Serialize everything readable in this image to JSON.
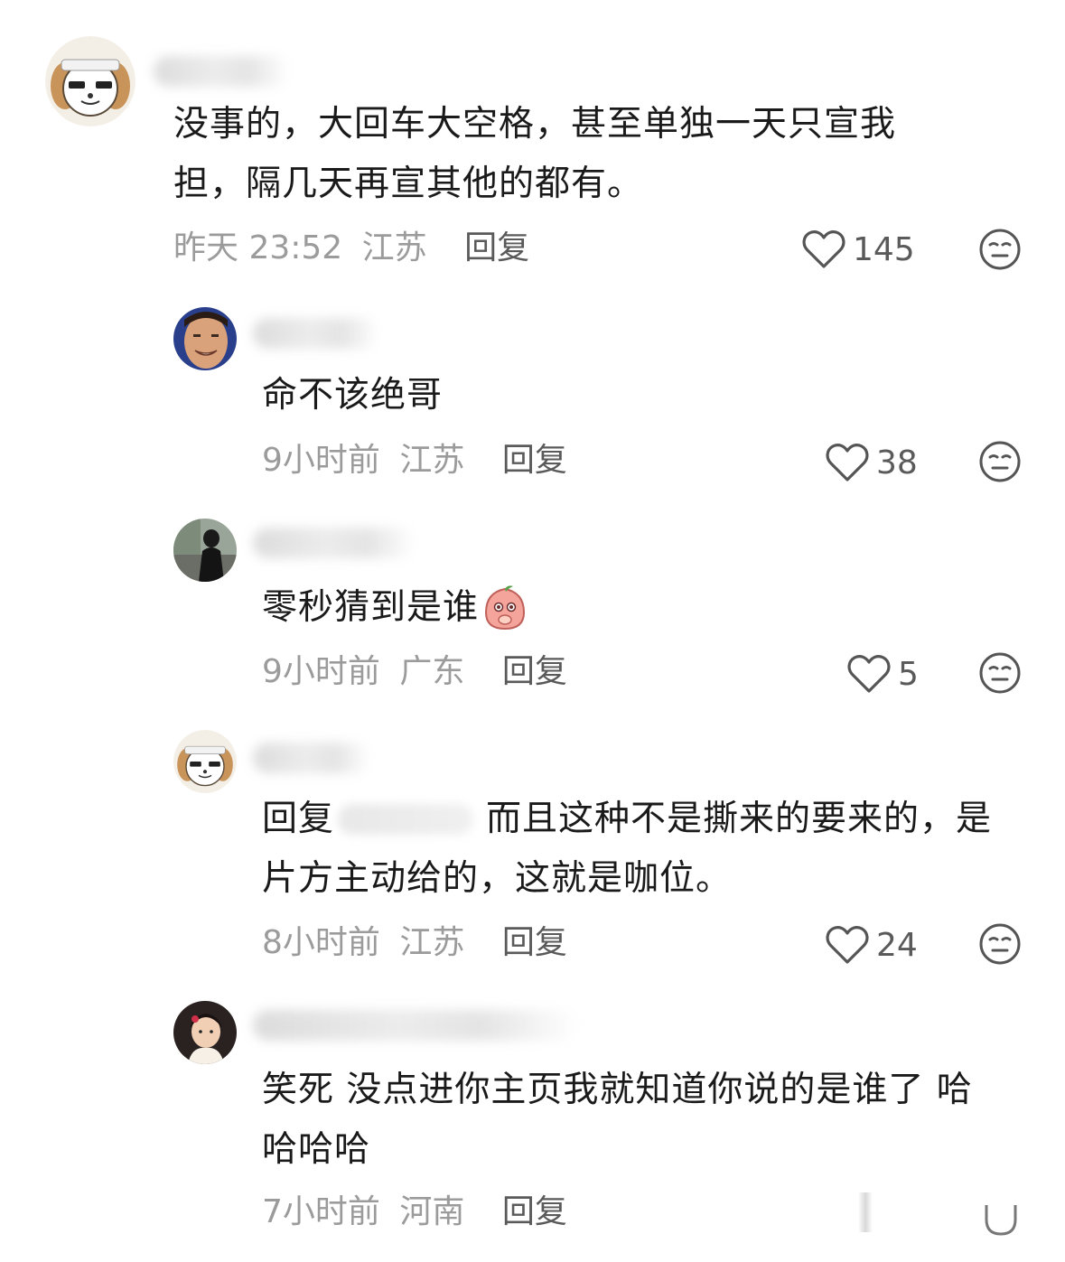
{
  "comments": [
    {
      "id": "c1",
      "text_lines": [
        "没事的，大回车大空格，甚至单独一天只宣我",
        "担，隔几天再宣其他的都有。"
      ],
      "time": "昨天 23:52",
      "location": "江苏",
      "reply_label": "回复",
      "likes": "145",
      "avatar_icon": "dog-avatar"
    },
    {
      "id": "c2",
      "text": "命不该绝哥",
      "time": "9小时前",
      "location": "江苏",
      "reply_label": "回复",
      "likes": "38",
      "avatar_icon": "smiling-man-avatar"
    },
    {
      "id": "c3",
      "text": "零秒猜到是谁",
      "emoji": "peach-cover-mouth-emoji",
      "time": "9小时前",
      "location": "广东",
      "reply_label": "回复",
      "likes": "5",
      "avatar_icon": "person-outdoor-avatar"
    },
    {
      "id": "c4",
      "reply_prefix": "回复",
      "text_line1": "而且这种不是撕来的要来的，是",
      "text_line2": "片方主动给的，这就是咖位。",
      "time": "8小时前",
      "location": "江苏",
      "reply_label": "回复",
      "likes": "24",
      "avatar_icon": "dog-avatar"
    },
    {
      "id": "c5",
      "text_lines": [
        "笑死 没点进你主页我就知道你说的是谁了 哈",
        "哈哈哈"
      ],
      "time": "7小时前",
      "location": "河南",
      "reply_label": "回复",
      "avatar_icon": "girl-avatar"
    }
  ],
  "icons": {
    "like": "heart-outline-icon",
    "dislike": "neutral-face-icon"
  },
  "colors": {
    "text": "#1a1a1a",
    "meta": "#9b9b9b",
    "reply": "#5a5a5a",
    "icon": "#555555"
  }
}
